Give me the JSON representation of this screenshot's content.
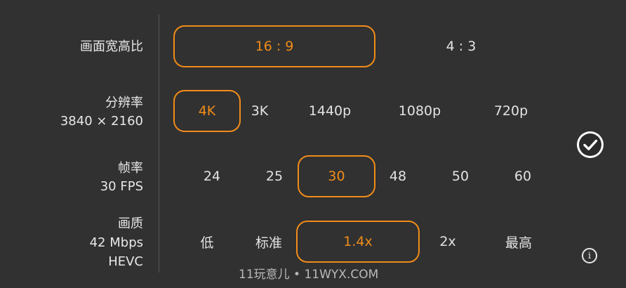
{
  "aspect": {
    "label": "画面宽高比",
    "options": [
      "16 : 9",
      "4 : 3"
    ],
    "selected": "16 : 9"
  },
  "resolution": {
    "label": "分辨率",
    "sub": "3840 × 2160",
    "options": [
      "4K",
      "3K",
      "1440p",
      "1080p",
      "720p"
    ],
    "selected": "4K"
  },
  "framerate": {
    "label": "帧率",
    "sub": "30 FPS",
    "options": [
      "24",
      "25",
      "30",
      "48",
      "50",
      "60"
    ],
    "selected": "30"
  },
  "quality": {
    "label": "画质",
    "sub1": "42 Mbps",
    "sub2": "HEVC",
    "options": [
      "低",
      "标准",
      "1.4x",
      "2x",
      "最高"
    ],
    "selected": "1.4x"
  },
  "icons": {
    "confirm": "checkmark-circle-icon",
    "info": "info-icon",
    "info_glyph": "i"
  },
  "watermark": "11玩意儿 • 11WYX.COM",
  "colors": {
    "background": "#313131",
    "accent": "#f08c19",
    "text": "#e6e6e6"
  }
}
